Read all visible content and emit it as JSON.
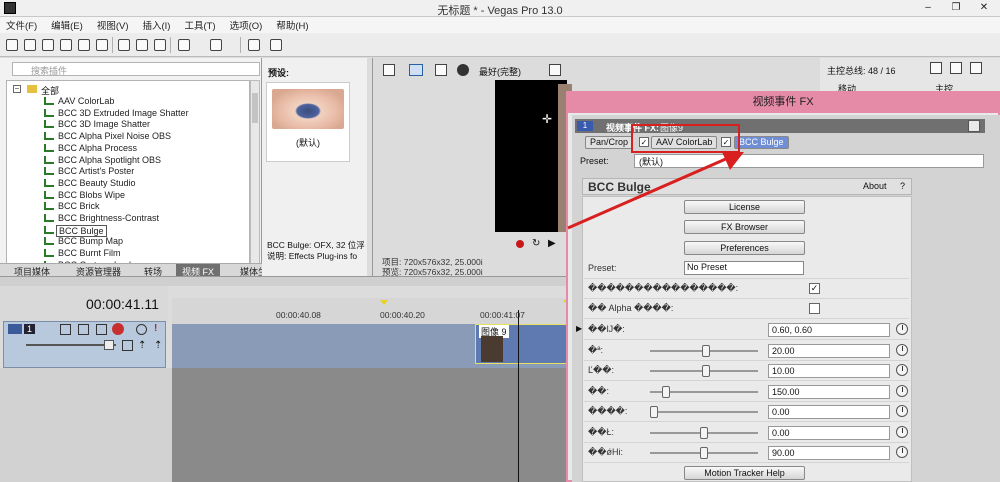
{
  "window": {
    "title": "无标题 * - Vegas Pro 13.0",
    "minimize": "–",
    "maximize": "❐",
    "close": "✕"
  },
  "menu": [
    "文件(F)",
    "编辑(E)",
    "视图(V)",
    "插入(I)",
    "工具(T)",
    "选项(O)",
    "帮助(H)"
  ],
  "browser": {
    "search_placeholder": "搜索插件",
    "root": "全部",
    "items": [
      "AAV ColorLab",
      "BCC 3D Extruded Image Shatter",
      "BCC 3D Image Shatter",
      "BCC Alpha Pixel Noise OBS",
      "BCC Alpha Process",
      "BCC Alpha Spotlight OBS",
      "BCC Artist's Poster",
      "BCC Beauty Studio",
      "BCC Blobs Wipe",
      "BCC Brick",
      "BCC Brightness-Contrast",
      "BCC Bulge",
      "BCC Bump Map",
      "BCC Burnt Film",
      "BCC Cartoon Look"
    ],
    "selected": "BCC Bulge"
  },
  "tabs": [
    "项目媒体",
    "资源管理器",
    "转场",
    "视频 FX",
    "媒体生成器"
  ],
  "active_tab": "视频 FX",
  "preview": {
    "label": "预设:",
    "default_name": "(默认)",
    "desc_line1": "BCC Bulge: OFX, 32 位浮",
    "desc_line2": "说明: Effects Plug-ins fo"
  },
  "video": {
    "quality": "最好(完整)",
    "project_info": "项目: 720x576x32, 25.000i",
    "preview_info": "预览: 720x576x32, 25.000i"
  },
  "master": {
    "label": "主控总线: 48 / 16",
    "col1": "移动",
    "col2": "主控"
  },
  "fx_window": {
    "title": "视频事件 FX",
    "chain_label": "视频事件 FX:",
    "chain_target": "图像9",
    "chain": [
      "Pan/Crop",
      "AAV ColorLab",
      "BCC Bulge"
    ],
    "preset_label": "Preset:",
    "preset_value": "(默认)"
  },
  "bcc": {
    "title": "BCC Bulge",
    "about": "About",
    "help": "?",
    "license": "License",
    "fx_browser": "FX Browser",
    "preferences": "Preferences",
    "preset_label": "Preset:",
    "preset_value": "No Preset",
    "row_check1": "����������������:",
    "row_check2": "�� Alpha ����:",
    "params": [
      {
        "label": "��Ĳ�:",
        "value": "0.60, 0.60"
      },
      {
        "label": "�ª:",
        "value": "20.00"
      },
      {
        "label": "Ľ��:",
        "value": "10.00"
      },
      {
        "label": "��:",
        "value": "150.00"
      },
      {
        "label": "����:",
        "value": "0.00"
      },
      {
        "label": "��Ł:",
        "value": "0.00"
      },
      {
        "label": "��ǿHi:",
        "value": "90.00"
      }
    ],
    "motion_tracker": "Motion Tracker Help"
  },
  "timeline": {
    "timecode": "00:00:41.11",
    "ticks": [
      "00:00:40.08",
      "00:00:40.20",
      "00:00:41:07"
    ],
    "clip_label": "图像 9",
    "track_number": "1"
  }
}
